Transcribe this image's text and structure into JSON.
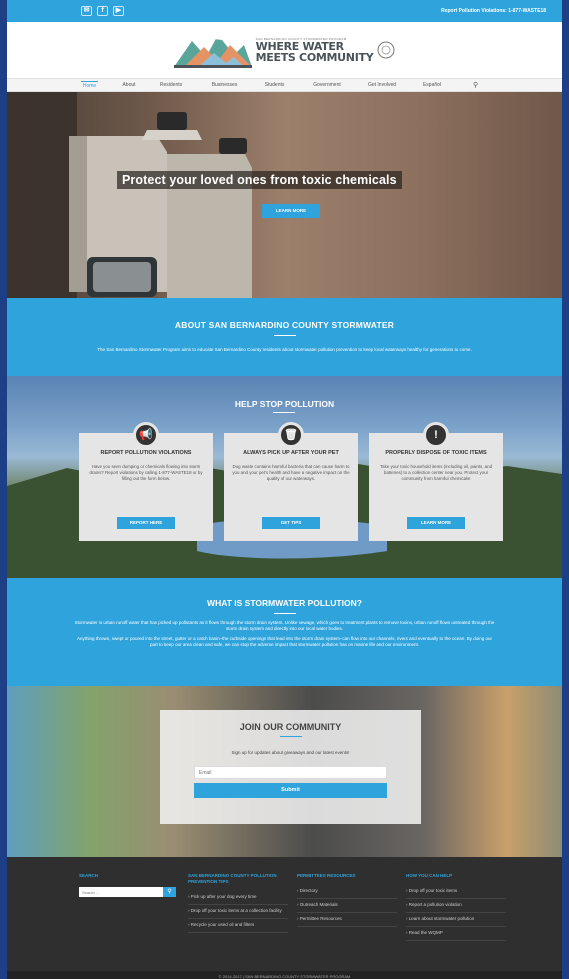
{
  "topbar": {
    "social_icons": [
      "email-icon",
      "facebook-icon",
      "youtube-icon"
    ],
    "report_text": "Report Pollution Violations: 1-877-WASTE18"
  },
  "logo": {
    "tagline": "SAN BERNARDINO COUNTY STORMWATER PROGRAM",
    "line1": "WHERE WATER",
    "line2": "MEETS COMMUNITY"
  },
  "nav": {
    "items": [
      "Home",
      "About",
      "Residents",
      "Businesses",
      "Students",
      "Government",
      "Get Involved",
      "Español"
    ],
    "search_icon": "search-icon"
  },
  "hero": {
    "title": "Protect your loved ones from toxic chemicals",
    "button": "LEARN MORE"
  },
  "about": {
    "title": "ABOUT SAN BERNARDINO COUNTY STORMWATER",
    "text": "The San Bernardino Stormwater Program aims to educate San Bernardino County residents about stormwater pollution prevention to keep local waterways healthy for generations to come."
  },
  "help": {
    "title": "HELP STOP POLLUTION",
    "cards": [
      {
        "icon": "megaphone-icon",
        "title": "REPORT POLLUTION VIOLATIONS",
        "text": "Have you seen dumping or chemicals flowing into storm drains? Report violations by calling 1-877-WASTE18 or by filling out the form below.",
        "button": "REPORT HERE"
      },
      {
        "icon": "trash-icon",
        "title": "ALWAYS PICK UP AFTER YOUR PET",
        "text": "Dog waste contains harmful bacteria that can cause harm to you and your pet's health and have a negative impact on the quality of our waterways.",
        "button": "GET TIPS"
      },
      {
        "icon": "warning-icon",
        "title": "PROPERLY DISPOSE OF TOXIC ITEMS",
        "text": "Take your toxic household items (including oil, paints, and batteries) to a collection center near you. Protect your community from harmful chemicals!",
        "button": "LEARN MORE"
      }
    ]
  },
  "what": {
    "title": "WHAT IS STORMWATER POLLUTION?",
    "p1": "Stormwater is urban runoff water that has picked up pollutants as it flows through the storm drain system. Unlike sewage, which goes to treatment plants to remove toxins, urban runoff flows untreated through the storm drain system and directly into our local water bodies.",
    "p2": "Anything thrown, swept or poured into the street, gutter or a catch basin–the curbside openings that lead into the storm drain system–can flow into our channels, rivers and eventually to the ocean. By doing our part to keep our area clean and safe, we can stop the adverse impact that stormwater pollution has on marine life and our environment."
  },
  "join": {
    "title": "JOIN OUR COMMUNITY",
    "subtitle": "Sign up for updates about giveaways and our latest events!",
    "email_placeholder": "Email",
    "submit": "Submit"
  },
  "footer": {
    "search_title": "SEARCH",
    "search_placeholder": "Search ...",
    "tips_title": "SAN BERNARDINO COUNTY POLLUTION PREVENTION TIPS",
    "tips": [
      "Pick up after your dog every time",
      "Drop off your toxic items at a collection facility",
      "Recycle your used oil and filters"
    ],
    "permittees_title": "PERMITTEES RESOURCES",
    "permittees": [
      "Directory",
      "Outreach Materials",
      "Permittee Resources"
    ],
    "help_title": "HOW YOU CAN HELP",
    "help": [
      "Drop off your toxic items",
      "Report a pollution violation",
      "Learn about stormwater pollution",
      "Read the WQMP"
    ],
    "copyright": "© 2014-2017 | SAN BERNARDINO COUNTY STORMWATER PROGRAM"
  }
}
